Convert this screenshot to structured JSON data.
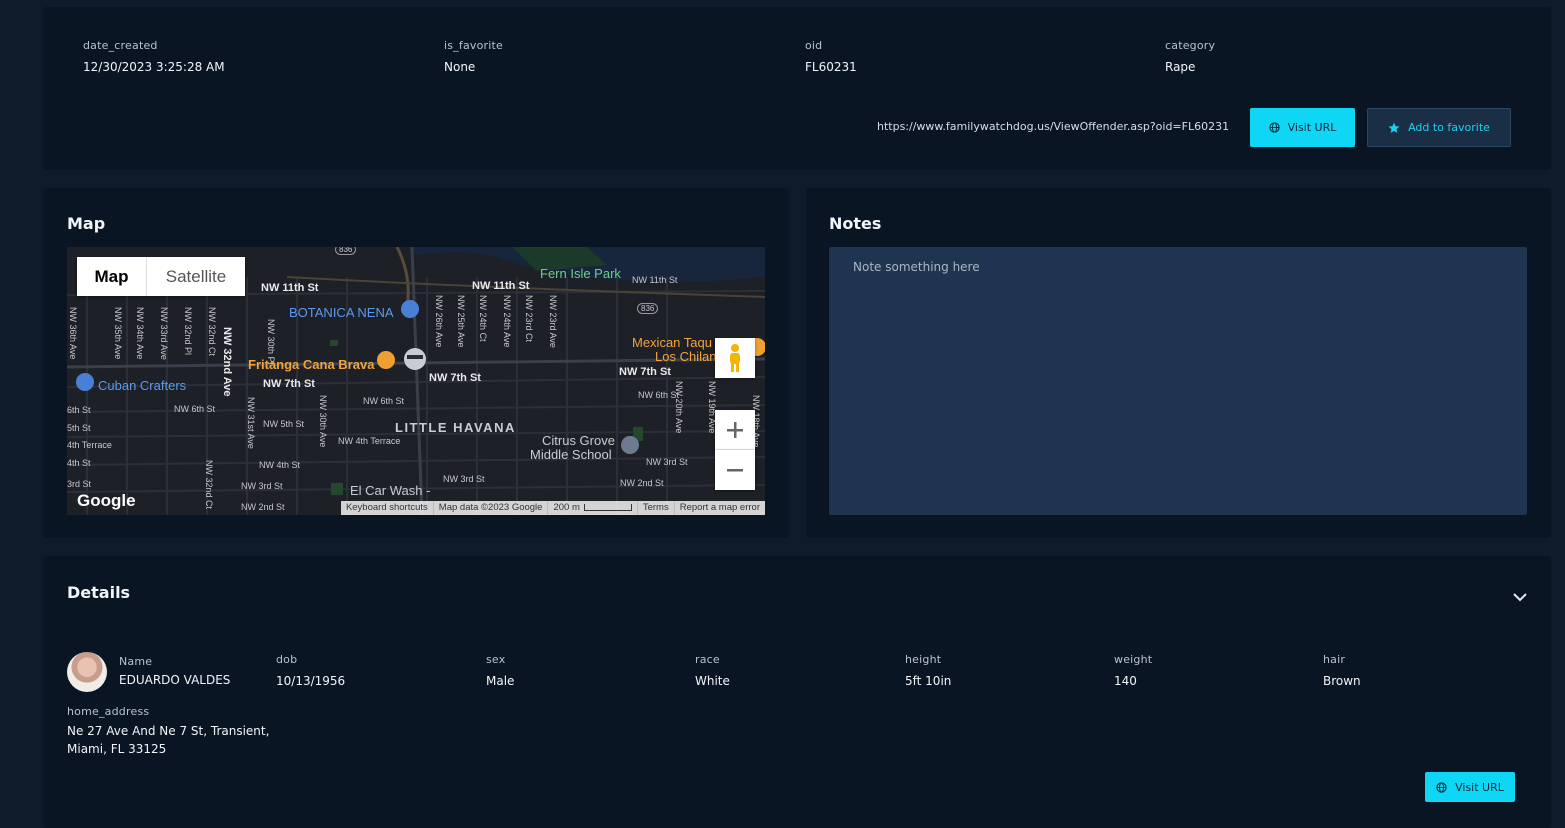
{
  "record": {
    "date_created": {
      "label": "date_created",
      "value": "12/30/2023 3:25:28 AM"
    },
    "is_favorite": {
      "label": "is_favorite",
      "value": "None"
    },
    "oid": {
      "label": "oid",
      "value": "FL60231"
    },
    "category": {
      "label": "category",
      "value": "Rape"
    },
    "url": "https://www.familywatchdog.us/ViewOffender.asp?oid=FL60231",
    "visit_url_label": "Visit URL",
    "add_favorite_label": "Add to favorite"
  },
  "map": {
    "title": "Map",
    "toggle_map": "Map",
    "toggle_satellite": "Satellite",
    "google": "Google",
    "attribution": {
      "keyboard": "Keyboard shortcuts",
      "data": "Map data ©2023 Google",
      "scale": "200 m",
      "terms": "Terms",
      "report": "Report a map error"
    },
    "places": {
      "botanica": "BOTANICA NENA",
      "fritanga": "Fritanga Cana Brava",
      "cuban": "Cuban Crafters",
      "mexican1": "Mexican Taqu",
      "mexican2": "Los Chilan",
      "fern": "Fern Isle Park",
      "little_havana": "LITTLE HAVANA",
      "citrus1": "Citrus Grove",
      "citrus2": "Middle School",
      "carwash": "El Car Wash -"
    },
    "streets": {
      "nw11_a": "NW 11th St",
      "nw11_b": "NW 11th St",
      "nw11_c": "NW 11th St",
      "nw7_a": "NW 7th St",
      "nw7_b": "NW 7th St",
      "nw7_c": "NW 7th St",
      "nw6_a": "NW 6th St",
      "nw6_b": "NW 6th St",
      "nw6_c": "NW 6th St",
      "nw5": "NW 5th St",
      "nw4t": "NW 4th Terrace",
      "nw4": "NW 4th St",
      "nw3_a": "NW 3rd St",
      "nw3_b": "NW 3rd St",
      "nw3_c": "NW 3rd St",
      "nw2_a": "NW 2nd St",
      "nw2_b": "NW 2nd St",
      "s6": "6th St",
      "s5": "5th St",
      "s4t": "4th Terrace",
      "s4": "4th St",
      "s3": "3rd St",
      "r836a": "836",
      "r836b": "836",
      "nw36": "NW 36th Ave",
      "nw35": "NW 35th Ave",
      "nw34": "NW 34th Ave",
      "nw33": "NW 33rd Ave",
      "nw32pl": "NW 32nd Pl",
      "nw32ct": "NW 32nd Ct",
      "nw32ave": "NW 32nd Ave",
      "nw30pl": "NW 30th Pl",
      "nw31": "NW 31st Ave",
      "nw30ave": "NW 30th Ave",
      "nw26": "NW 26th Ave",
      "nw25": "NW 25th Ave",
      "nw24ct": "NW 24th Ct",
      "nw24": "NW 24th Ave",
      "nw23ct": "NW 23rd Ct",
      "nw23": "NW 23rd Ave",
      "nw20": "NW 20th Ave",
      "nw19": "NW 19th Ave",
      "nw18": "NW 18th Ave",
      "nw32ct2": "NW 32nd Ct"
    }
  },
  "notes": {
    "title": "Notes",
    "placeholder": "Note something here"
  },
  "details": {
    "title": "Details",
    "name": {
      "label": "Name",
      "value": "EDUARDO VALDES"
    },
    "dob": {
      "label": "dob",
      "value": "10/13/1956"
    },
    "sex": {
      "label": "sex",
      "value": "Male"
    },
    "race": {
      "label": "race",
      "value": "White"
    },
    "height": {
      "label": "height",
      "value": "5ft 10in"
    },
    "weight": {
      "label": "weight",
      "value": "140"
    },
    "hair": {
      "label": "hair",
      "value": "Brown"
    },
    "home_address": {
      "label": "home_address",
      "line1": "Ne 27 Ave And Ne 7 St, Transient,",
      "line2": "Miami, FL 33125"
    },
    "visit_url_label": "Visit URL"
  },
  "colors": {
    "accent": "#10d6f5",
    "background": "#0d1b2a",
    "card": "#0a1523",
    "notes_bg": "#1f3450"
  }
}
